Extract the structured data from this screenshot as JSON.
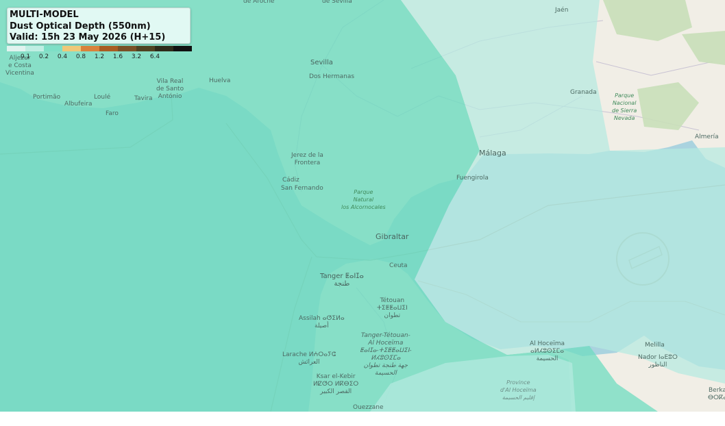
{
  "legend": {
    "title_line1": "MULTI-MODEL",
    "title_line2": "Dust Optical Depth (550nm)",
    "title_line3": "Valid: 15h 23 May 2026 (H+15)",
    "colors": [
      "#e1f3ef",
      "#bfeee3",
      "#7ddfc6",
      "#efc878",
      "#d9823b",
      "#a85d22",
      "#7a5126",
      "#4f4322",
      "#2e2b1a",
      "#111111"
    ],
    "ticks": [
      "0.1",
      "0.2",
      "0.4",
      "0.8",
      "1.2",
      "1.6",
      "3.2",
      "6.4"
    ]
  },
  "map": {
    "land_color": "#f1eee6",
    "sea_color": "#aad3df",
    "overlay_mid": "#6fdcc0",
    "overlay_light": "#b5eae0"
  },
  "places": {
    "sevilla": "Sevilla",
    "dos_hermanas": "Dos Hermanas",
    "huelva": "Huelva",
    "portimao": "Portimão",
    "albufeira": "Albufeira",
    "loule": "Loulé",
    "faro": "Faro",
    "tavira": "Tavira",
    "vila_real_1": "Vila Real",
    "vila_real_2": "de Santo",
    "vila_real_3": "António",
    "aljezur_1": "Aljezur",
    "aljezur_2": "e Costa",
    "aljezur_3": "Vicentina",
    "jerez_1": "Jerez de la",
    "jerez_2": "Frontera",
    "cadiz": "Cádiz",
    "san_fernando": "San Fernando",
    "park_alc_1": "Parque",
    "park_alc_2": "Natural",
    "park_alc_3": "los Alcornocales",
    "malaga": "Málaga",
    "fuengirola": "Fuengirola",
    "granada": "Granada",
    "jaen": "Jaén",
    "park_sn_1": "Parque",
    "park_sn_2": "Nacional",
    "park_sn_3": "de Sierra",
    "park_sn_4": "Nevada",
    "almeria": "Almería",
    "gibraltar": "Gibraltar",
    "ceuta": "Ceuta",
    "tanger_1": "Tanger ⵟⴰⵏⵊⴰ",
    "tanger_2": "طنجة",
    "tetouan_1": "Tétouan",
    "tetouan_2": "ⵜⵉⵟⵟⴰⵡⵉⵏ",
    "tetouan_3": "تطوان",
    "assilah_1": "Assilah ⴰⵚⵉⵍⴰ",
    "assilah_2": "أصيلة",
    "larache_1": "Larache ⵍⵄⵔⴰⵢⵛ",
    "larache_2": "العرائش",
    "tt_1": "Tanger-Tétouan-",
    "tt_2": "Al Hoceïma",
    "tt_3": "ⵟⴰⵏⵊⴰ-ⵜⵉⵟⵟⴰⵡⵉⵏ-",
    "tt_4": "ⵍⵃⵓⵙⵉⵎⴰ",
    "tt_5": "جهة طنجة تطوان",
    "tt_6": "الحسيمة",
    "ksar_1": "Ksar el-Kebir",
    "ksar_2": "ⵍⵇⵚⵔ ⵍⴽⴱⵉⵔ",
    "ksar_3": "القصر الكبير",
    "ouezzane": "Ouezzane",
    "hoceima_1": "Al Hoceïma",
    "hoceima_2": "ⴰⵍⵃⵓⵙⵉⵎⴰ",
    "hoceima_3": "الحسيمة",
    "prov_1": "Province",
    "prov_2": "d'Al Hoceïma",
    "prov_3": "إقليم الحسيمة",
    "melilla": "Melilla",
    "nador_1": "Nador ⵏⴰⴹⵓⵔ",
    "nador_2": "الناظور",
    "berkane_1": "Berka",
    "berkane_2": "ⴱⵔⴽⴰ",
    "aroche": "de Aroche",
    "sevilla_top": "de Sevilla"
  }
}
